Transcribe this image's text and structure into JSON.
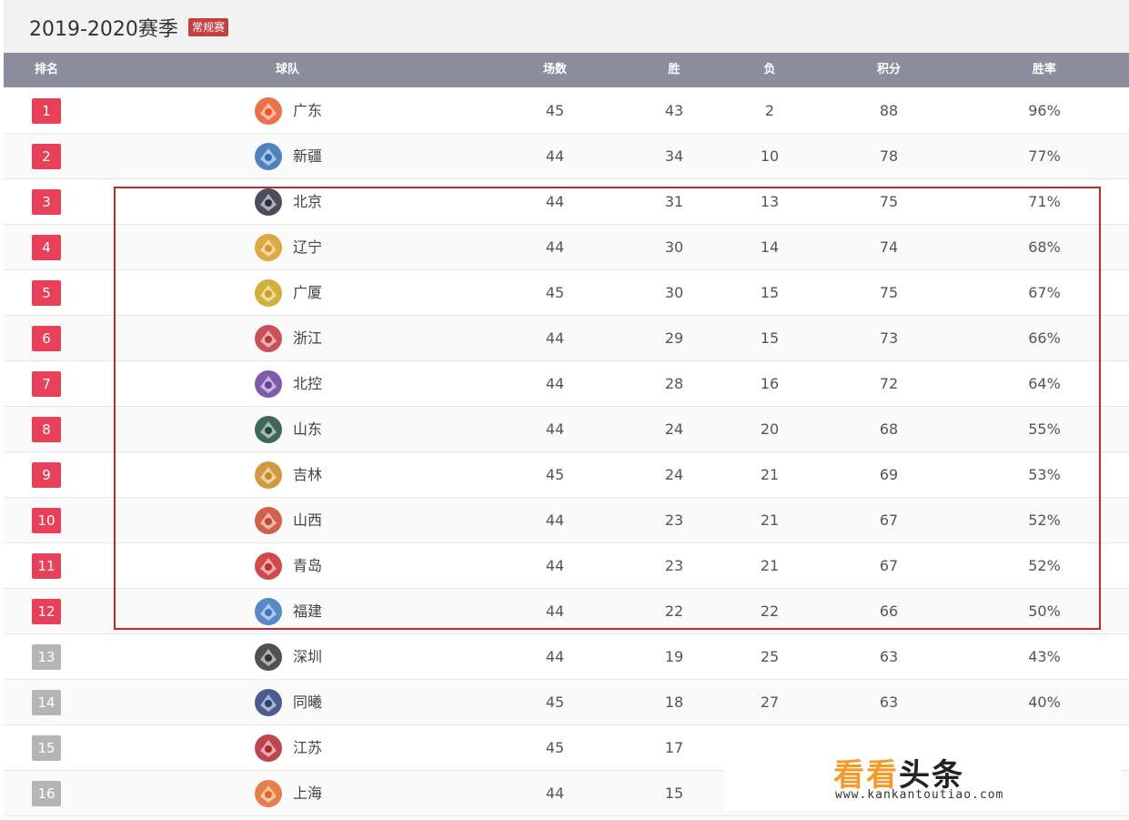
{
  "header": {
    "season": "2019-2020赛季",
    "badge": "常规赛"
  },
  "table": {
    "columns": [
      "排名",
      "球队",
      "场数",
      "胜",
      "负",
      "积分",
      "胜率"
    ],
    "rows": [
      {
        "rank": "1",
        "team": "广东",
        "games": "45",
        "wins": "43",
        "losses": "2",
        "points": "88",
        "win_rate": "96%",
        "logo": "guangdong-logo-icon"
      },
      {
        "rank": "2",
        "team": "新疆",
        "games": "44",
        "wins": "34",
        "losses": "10",
        "points": "78",
        "win_rate": "77%",
        "logo": "xinjiang-logo-icon"
      },
      {
        "rank": "3",
        "team": "北京",
        "games": "44",
        "wins": "31",
        "losses": "13",
        "points": "75",
        "win_rate": "71%",
        "logo": "beijing-logo-icon"
      },
      {
        "rank": "4",
        "team": "辽宁",
        "games": "44",
        "wins": "30",
        "losses": "14",
        "points": "74",
        "win_rate": "68%",
        "logo": "liaoning-logo-icon"
      },
      {
        "rank": "5",
        "team": "广厦",
        "games": "45",
        "wins": "30",
        "losses": "15",
        "points": "75",
        "win_rate": "67%",
        "logo": "guangsha-logo-icon"
      },
      {
        "rank": "6",
        "team": "浙江",
        "games": "44",
        "wins": "29",
        "losses": "15",
        "points": "73",
        "win_rate": "66%",
        "logo": "zhejiang-logo-icon"
      },
      {
        "rank": "7",
        "team": "北控",
        "games": "44",
        "wins": "28",
        "losses": "16",
        "points": "72",
        "win_rate": "64%",
        "logo": "beikong-logo-icon"
      },
      {
        "rank": "8",
        "team": "山东",
        "games": "44",
        "wins": "24",
        "losses": "20",
        "points": "68",
        "win_rate": "55%",
        "logo": "shandong-logo-icon"
      },
      {
        "rank": "9",
        "team": "吉林",
        "games": "45",
        "wins": "24",
        "losses": "21",
        "points": "69",
        "win_rate": "53%",
        "logo": "jilin-logo-icon"
      },
      {
        "rank": "10",
        "team": "山西",
        "games": "44",
        "wins": "23",
        "losses": "21",
        "points": "67",
        "win_rate": "52%",
        "logo": "shanxi-logo-icon"
      },
      {
        "rank": "11",
        "team": "青岛",
        "games": "44",
        "wins": "23",
        "losses": "21",
        "points": "67",
        "win_rate": "52%",
        "logo": "qingdao-logo-icon"
      },
      {
        "rank": "12",
        "team": "福建",
        "games": "44",
        "wins": "22",
        "losses": "22",
        "points": "66",
        "win_rate": "50%",
        "logo": "fujian-logo-icon"
      },
      {
        "rank": "13",
        "team": "深圳",
        "games": "44",
        "wins": "19",
        "losses": "25",
        "points": "63",
        "win_rate": "43%",
        "logo": "shenzhen-logo-icon"
      },
      {
        "rank": "14",
        "team": "同曦",
        "games": "45",
        "wins": "18",
        "losses": "27",
        "points": "63",
        "win_rate": "40%",
        "logo": "tongxi-logo-icon"
      },
      {
        "rank": "15",
        "team": "江苏",
        "games": "45",
        "wins": "17",
        "losses": "",
        "points": "",
        "win_rate": "",
        "logo": "jiangsu-logo-icon"
      },
      {
        "rank": "16",
        "team": "上海",
        "games": "44",
        "wins": "15",
        "losses": "",
        "points": "",
        "win_rate": "",
        "logo": "shanghai-logo-icon"
      }
    ]
  },
  "watermark": {
    "brand_a": "看看",
    "brand_b": "头条",
    "url": "www.kankantoutiao.com"
  },
  "colors": {
    "header_bar": "#8c8d9c",
    "rank_top": "#e9405a",
    "rank_rest": "#b5b5b5",
    "highlight_border": "#c6262e",
    "badge": "#c0413f"
  }
}
